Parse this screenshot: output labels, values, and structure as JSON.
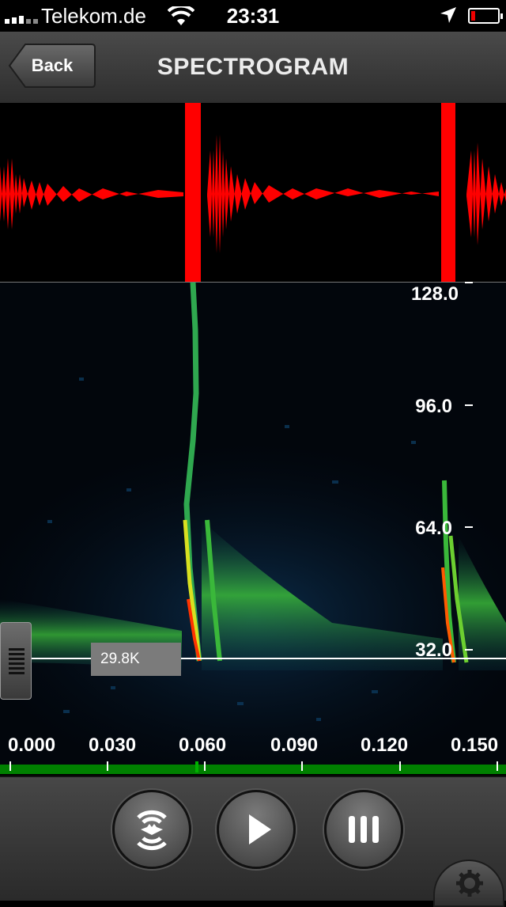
{
  "status_bar": {
    "carrier": "Telekom.de",
    "time": "23:31"
  },
  "nav": {
    "back_label": "Back",
    "title": "SPECTROGRAM"
  },
  "spectrogram": {
    "y_axis_labels": [
      "128.0",
      "96.0",
      "64.0",
      "32.0"
    ],
    "x_axis_labels": [
      "0.000",
      "0.030",
      "0.060",
      "0.090",
      "0.120",
      "0.150"
    ],
    "cursor_frequency": "29.8K"
  },
  "toolbar": {
    "buttons": [
      "bat-detect",
      "play",
      "pause"
    ]
  },
  "colors": {
    "waveform": "#ff0000",
    "axis_green": "#008000",
    "spectrum_high": "#ff3300",
    "spectrum_mid": "#33cc33",
    "spectrum_low": "#0a3a5a"
  }
}
